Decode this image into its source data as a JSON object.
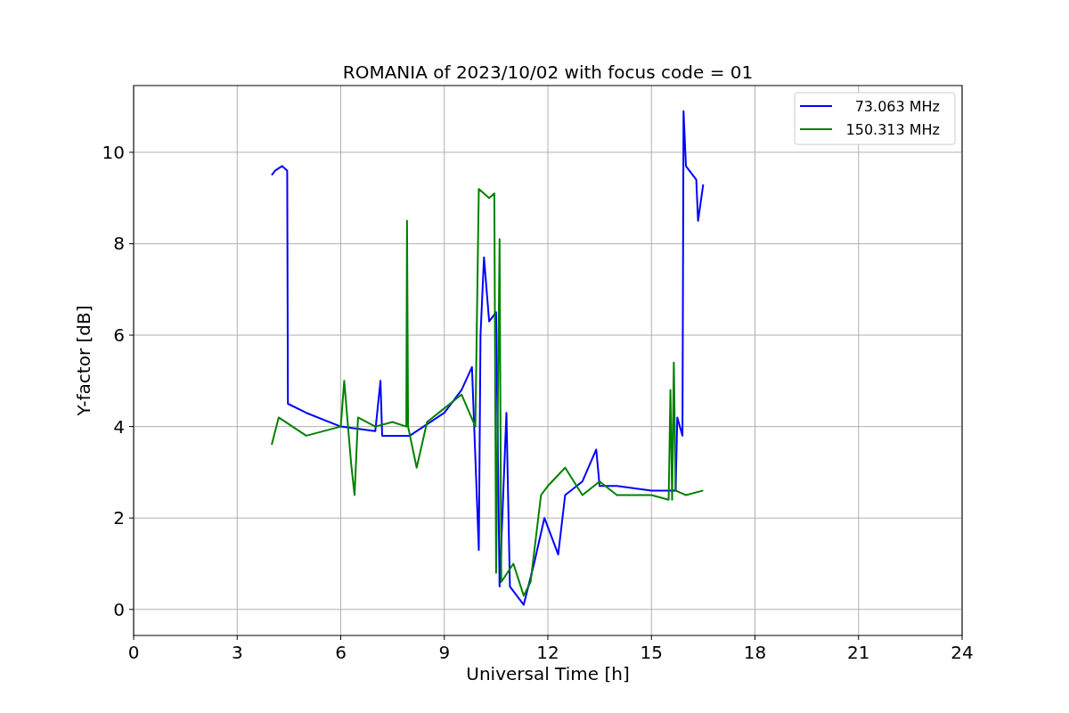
{
  "chart_data": {
    "type": "line",
    "title": "ROMANIA of 2023/10/02 with focus code = 01",
    "xlabel": "Universal Time [h]",
    "ylabel": "Y-factor [dB]",
    "xlim": [
      0,
      24
    ],
    "ylim": [
      -0.57,
      11.46
    ],
    "xticks": [
      0,
      3,
      6,
      9,
      12,
      15,
      18,
      21,
      24
    ],
    "yticks": [
      0,
      2,
      4,
      6,
      8,
      10
    ],
    "grid": true,
    "legend": true,
    "series": [
      {
        "name": "73.063 MHz",
        "color": "#0000ff",
        "x": [
          4.0,
          4.1,
          4.3,
          4.45,
          4.47,
          5,
          6,
          7,
          7.15,
          7.2,
          8,
          9,
          9.5,
          9.8,
          10.0,
          10.05,
          10.15,
          10.3,
          10.5,
          10.6,
          10.8,
          10.9,
          11.3,
          11.6,
          11.9,
          12.1,
          12.3,
          12.5,
          13,
          13.4,
          13.5,
          14,
          15,
          15.7,
          15.75,
          15.9,
          15.93,
          16,
          16.3,
          16.35,
          16.5
        ],
        "values": [
          9.5,
          9.6,
          9.7,
          9.6,
          4.5,
          4.3,
          4.0,
          3.9,
          5.0,
          3.8,
          3.8,
          4.3,
          4.8,
          5.3,
          1.3,
          6.0,
          7.7,
          6.3,
          6.5,
          0.5,
          4.3,
          0.5,
          0.1,
          1.0,
          2.0,
          1.6,
          1.2,
          2.5,
          2.8,
          3.5,
          2.7,
          2.7,
          2.6,
          2.6,
          4.2,
          3.8,
          10.9,
          9.7,
          9.4,
          8.5,
          9.3
        ]
      },
      {
        "name": "150.313 MHz",
        "color": "#008000",
        "x": [
          4.0,
          4.2,
          5,
          6,
          6.1,
          6.3,
          6.4,
          6.5,
          7,
          7.5,
          7.9,
          7.92,
          7.95,
          8.2,
          8.5,
          9,
          9.5,
          9.9,
          10.0,
          10.3,
          10.45,
          10.5,
          10.6,
          10.65,
          11,
          11.3,
          11.5,
          11.8,
          12,
          12.5,
          13,
          13.5,
          14,
          15,
          15.5,
          15.55,
          15.6,
          15.65,
          15.7,
          16,
          16.5
        ],
        "values": [
          3.6,
          4.2,
          3.8,
          4.0,
          5.0,
          3.2,
          2.5,
          4.2,
          4.0,
          4.1,
          4.0,
          8.5,
          4.0,
          3.1,
          4.1,
          4.4,
          4.7,
          4.0,
          9.2,
          9.0,
          9.1,
          0.8,
          8.1,
          0.6,
          1.0,
          0.3,
          0.6,
          2.5,
          2.7,
          3.1,
          2.5,
          2.8,
          2.5,
          2.5,
          2.4,
          4.8,
          2.4,
          5.4,
          2.6,
          2.5,
          2.6
        ]
      }
    ]
  }
}
